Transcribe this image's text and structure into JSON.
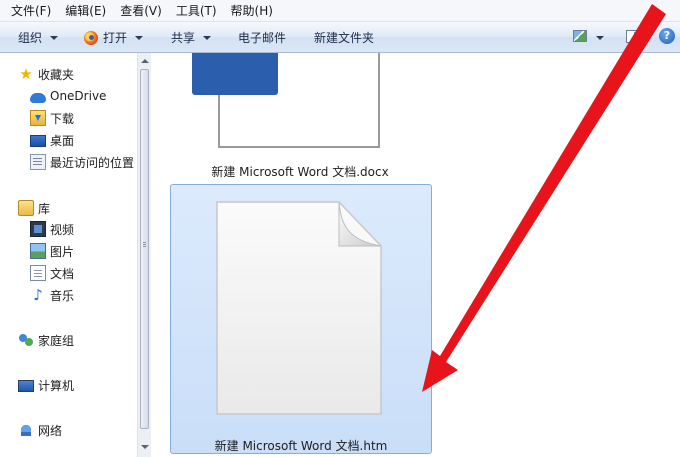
{
  "menubar": {
    "items": [
      "文件(F)",
      "编辑(E)",
      "查看(V)",
      "工具(T)",
      "帮助(H)"
    ]
  },
  "toolbar": {
    "organize": "组织",
    "open": "打开",
    "share": "共享",
    "email": "电子邮件",
    "new_folder": "新建文件夹",
    "help_glyph": "?"
  },
  "nav": {
    "favorites": "收藏夹",
    "onedrive": "OneDrive",
    "downloads": "下载",
    "desktop": "桌面",
    "recent": "最近访问的位置",
    "libraries": "库",
    "videos": "视频",
    "pictures": "图片",
    "documents": "文档",
    "music": "音乐",
    "homegroup": "家庭组",
    "computer": "计算机",
    "network": "网络"
  },
  "files": [
    {
      "name": "新建 Microsoft Word 文档.docx",
      "icon": "word-document-icon",
      "selected": false
    },
    {
      "name": "新建 Microsoft Word 文档.htm",
      "icon": "blank-file-icon",
      "selected": true
    }
  ],
  "colors": {
    "annotation_arrow": "#e8141b",
    "selection": "#cfe2fa",
    "word_blue": "#2b5fae"
  }
}
